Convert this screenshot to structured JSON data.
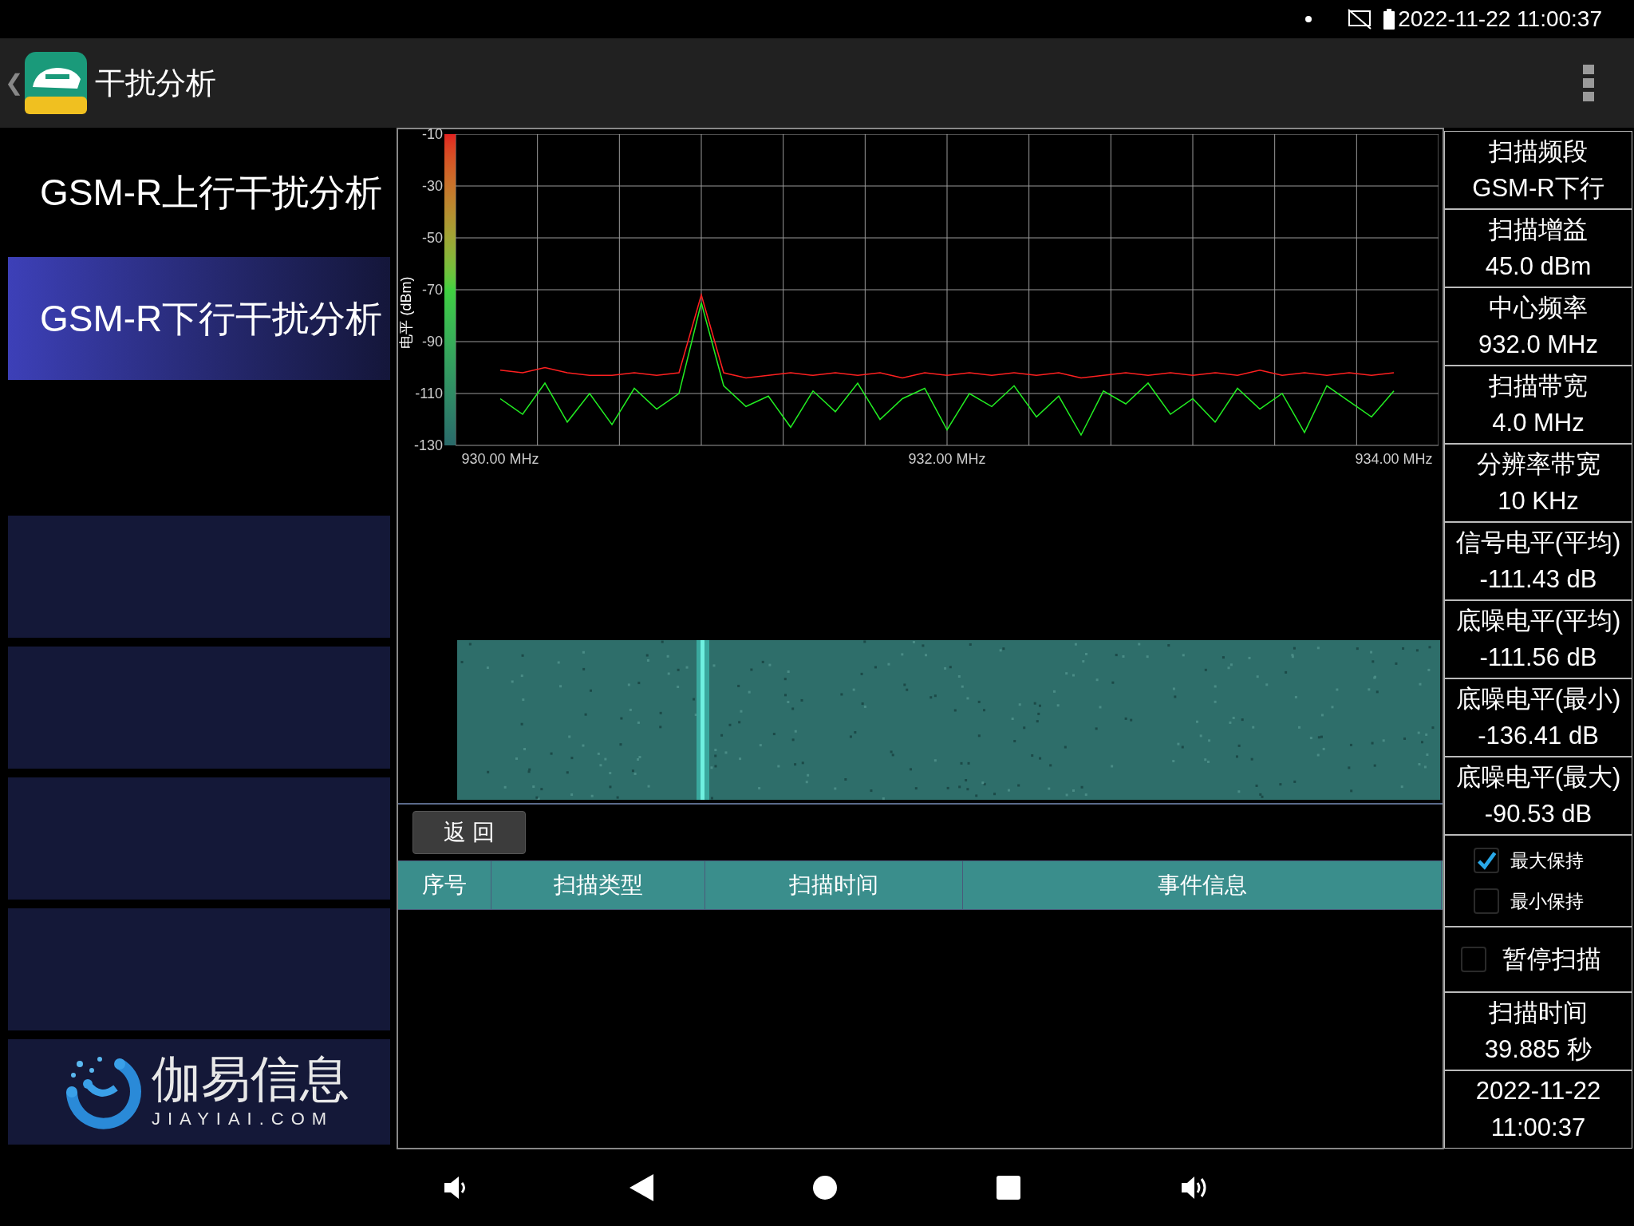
{
  "status_bar": {
    "time": "2022-11-22 11:00:37"
  },
  "app_bar": {
    "back": "❮",
    "title": "干扰分析"
  },
  "sidebar": {
    "items": [
      {
        "label": "GSM-R上行干扰分析",
        "selected": false
      },
      {
        "label": "GSM-R下行干扰分析",
        "selected": true
      }
    ],
    "logo": {
      "name": "伽易信息",
      "url": "JIAYIAI.COM"
    }
  },
  "spectrum": {
    "chart_data": {
      "type": "line",
      "ylabel": "电平 (dBm)",
      "xlim": [
        929.8,
        934.2
      ],
      "grid": true,
      "ylim": [
        -130,
        -10
      ],
      "yticks": [
        {
          "value": -10,
          "label": "-10"
        },
        {
          "value": -30,
          "label": "-30"
        },
        {
          "value": -50,
          "label": "-50"
        },
        {
          "value": -70,
          "label": "-70"
        },
        {
          "value": -90,
          "label": "-90"
        },
        {
          "value": -110,
          "label": "-110"
        },
        {
          "value": -130,
          "label": "-130"
        }
      ],
      "xticks": [
        {
          "value": 930,
          "label": "930.00 MHz"
        },
        {
          "value": 932,
          "label": "932.00 MHz"
        },
        {
          "value": 934,
          "label": "934.00 MHz"
        }
      ],
      "x": [
        930.0,
        930.1,
        930.2,
        930.3,
        930.4,
        930.5,
        930.6,
        930.7,
        930.8,
        930.9,
        931.0,
        931.1,
        931.2,
        931.3,
        931.4,
        931.5,
        931.6,
        931.7,
        931.8,
        931.9,
        932.0,
        932.1,
        932.2,
        932.3,
        932.4,
        932.5,
        932.6,
        932.7,
        932.8,
        932.9,
        933.0,
        933.1,
        933.2,
        933.3,
        933.4,
        933.5,
        933.6,
        933.7,
        933.8,
        933.9,
        934.0
      ],
      "series": [
        {
          "color": "#ff2020",
          "values": [
            -101,
            -102,
            -100,
            -102,
            -103,
            -103,
            -102,
            -103,
            -102,
            -72,
            -102,
            -104,
            -103,
            -102,
            -103,
            -102,
            -103,
            -102,
            -104,
            -102,
            -103,
            -102,
            -103,
            -102,
            -103,
            -102,
            -104,
            -103,
            -102,
            -103,
            -102,
            -103,
            -102,
            -103,
            -101,
            -103,
            -102,
            -103,
            -102,
            -103,
            -102
          ]
        },
        {
          "color": "#22ee22",
          "values": [
            -112,
            -118,
            -106,
            -121,
            -110,
            -122,
            -108,
            -116,
            -110,
            -75,
            -107,
            -115,
            -111,
            -123,
            -109,
            -117,
            -106,
            -120,
            -112,
            -108,
            -124,
            -110,
            -115,
            -107,
            -119,
            -111,
            -126,
            -109,
            -114,
            -106,
            -118,
            -112,
            -121,
            -108,
            -116,
            -110,
            -125,
            -107,
            -113,
            -119,
            -109
          ]
        }
      ]
    }
  },
  "back_button": "返 回",
  "table": {
    "columns": [
      "序号",
      "扫描类型",
      "扫描时间",
      "事件信息"
    ]
  },
  "info": [
    {
      "label": "扫描频段",
      "value": "GSM-R下行"
    },
    {
      "label": "扫描增益",
      "value": "45.0 dBm"
    },
    {
      "label": "中心频率",
      "value": "932.0 MHz"
    },
    {
      "label": "扫描带宽",
      "value": "4.0 MHz"
    },
    {
      "label": "分辨率带宽",
      "value": "10 KHz"
    },
    {
      "label": "信号电平(平均)",
      "value": "-111.43 dB"
    },
    {
      "label": "底噪电平(平均)",
      "value": "-111.56 dB"
    },
    {
      "label": "底噪电平(最小)",
      "value": "-136.41 dB"
    },
    {
      "label": "底噪电平(最大)",
      "value": "-90.53 dB"
    }
  ],
  "options": [
    {
      "label": "最大保持",
      "checked": true
    },
    {
      "label": "最小保持",
      "checked": false
    }
  ],
  "pause": {
    "label": "暂停扫描",
    "checked": false
  },
  "scan_time": {
    "label": "扫描时间",
    "value": "39.885 秒"
  },
  "datetime": {
    "date": "2022-11-22",
    "time": "11:00:37"
  }
}
